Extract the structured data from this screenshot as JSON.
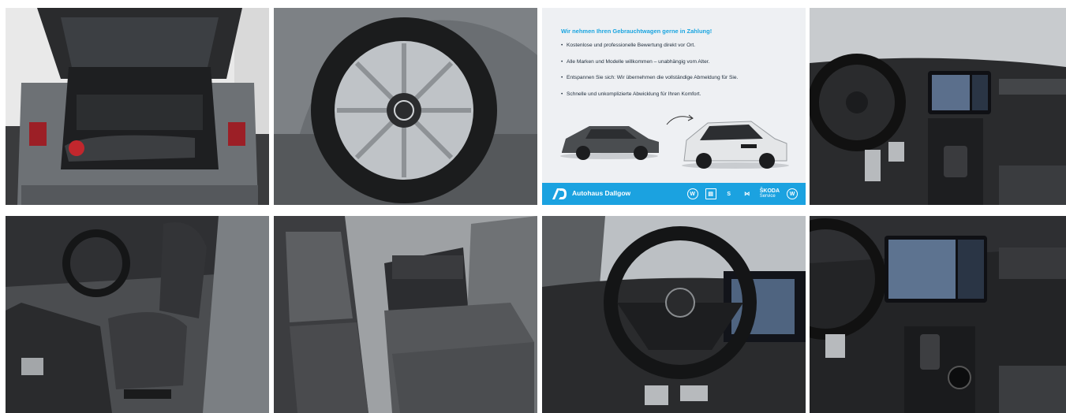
{
  "gallery": {
    "photos": [
      {
        "alt": "Kofferraum",
        "icon": "trunk-photo"
      },
      {
        "alt": "Felge",
        "icon": "wheel-photo"
      },
      {
        "alt": "Inzahlungnahme",
        "icon": "promo-banner"
      },
      {
        "alt": "Cockpit",
        "icon": "cockpit-photo"
      },
      {
        "alt": "Fahrersitz",
        "icon": "driver-seat-photo"
      },
      {
        "alt": "Rücksitzbank",
        "icon": "rear-seat-photo"
      },
      {
        "alt": "Lenkrad",
        "icon": "steering-wheel-photo"
      },
      {
        "alt": "Mittelkonsole",
        "icon": "center-console-photo"
      }
    ]
  },
  "promo": {
    "heading": "Wir nehmen Ihren Gebrauchtwagen gerne in Zahlung!",
    "bullets": [
      "Kostenlose und professionelle Bewertung direkt vor Ort.",
      "Alle Marken und Modelle willkommen – unabhängig vom Alter.",
      "Entspannen Sie sich: Wir übernehmen die vollständige Abmeldung für Sie.",
      "Schnelle und unkomplizierte Abwicklung für Ihren Komfort."
    ],
    "brand_name": "Autohaus Dallgow",
    "skoda_label": "ŠKODA",
    "skoda_sub": "Service",
    "accent_color": "#1ba2e0"
  }
}
